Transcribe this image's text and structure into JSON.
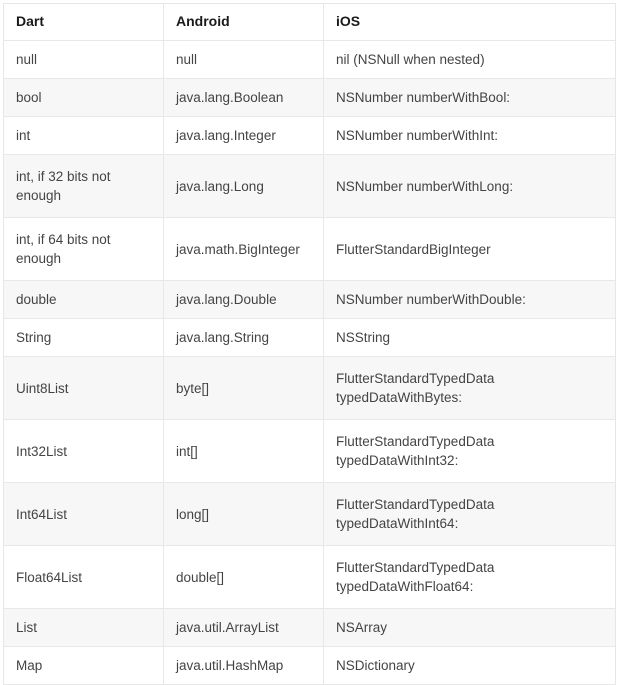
{
  "table": {
    "columns": [
      {
        "key": "dart",
        "label": "Dart"
      },
      {
        "key": "android",
        "label": "Android"
      },
      {
        "key": "ios",
        "label": "iOS"
      }
    ],
    "rows": [
      {
        "dart": "null",
        "android": "null",
        "ios": "nil (NSNull when nested)",
        "stripe": "white",
        "tall": false
      },
      {
        "dart": "bool",
        "android": "java.lang.Boolean",
        "ios": "NSNumber numberWithBool:",
        "stripe": "gray",
        "tall": false
      },
      {
        "dart": "int",
        "android": "java.lang.Integer",
        "ios": "NSNumber numberWithInt:",
        "stripe": "white",
        "tall": false
      },
      {
        "dart": "int, if 32 bits not enough",
        "android": "java.lang.Long",
        "ios": "NSNumber numberWithLong:",
        "stripe": "gray",
        "tall": true
      },
      {
        "dart": "int, if 64 bits not enough",
        "android": "java.math.BigInteger",
        "ios": "FlutterStandardBigInteger",
        "stripe": "white",
        "tall": true
      },
      {
        "dart": "double",
        "android": "java.lang.Double",
        "ios": "NSNumber numberWithDouble:",
        "stripe": "gray",
        "tall": false
      },
      {
        "dart": "String",
        "android": "java.lang.String",
        "ios": "NSString",
        "stripe": "white",
        "tall": false
      },
      {
        "dart": "Uint8List",
        "android": "byte[]",
        "ios": "FlutterStandardTypedData typedDataWithBytes:",
        "stripe": "gray",
        "tall": true
      },
      {
        "dart": "Int32List",
        "android": "int[]",
        "ios": "FlutterStandardTypedData typedDataWithInt32:",
        "stripe": "white",
        "tall": true
      },
      {
        "dart": "Int64List",
        "android": "long[]",
        "ios": "FlutterStandardTypedData typedDataWithInt64:",
        "stripe": "gray",
        "tall": true
      },
      {
        "dart": "Float64List",
        "android": "double[]",
        "ios": "FlutterStandardTypedData typedDataWithFloat64:",
        "stripe": "white",
        "tall": true
      },
      {
        "dart": "List",
        "android": "java.util.ArrayList",
        "ios": "NSArray",
        "stripe": "gray",
        "tall": false
      },
      {
        "dart": "Map",
        "android": "java.util.HashMap",
        "ios": "NSDictionary",
        "stripe": "white",
        "tall": false
      }
    ]
  },
  "colors": {
    "stripe_gray": "#f7f7f7",
    "stripe_white": "#ffffff",
    "border": "#e8e8e8",
    "header_text": "#1a1a1a",
    "body_text": "#444444"
  }
}
